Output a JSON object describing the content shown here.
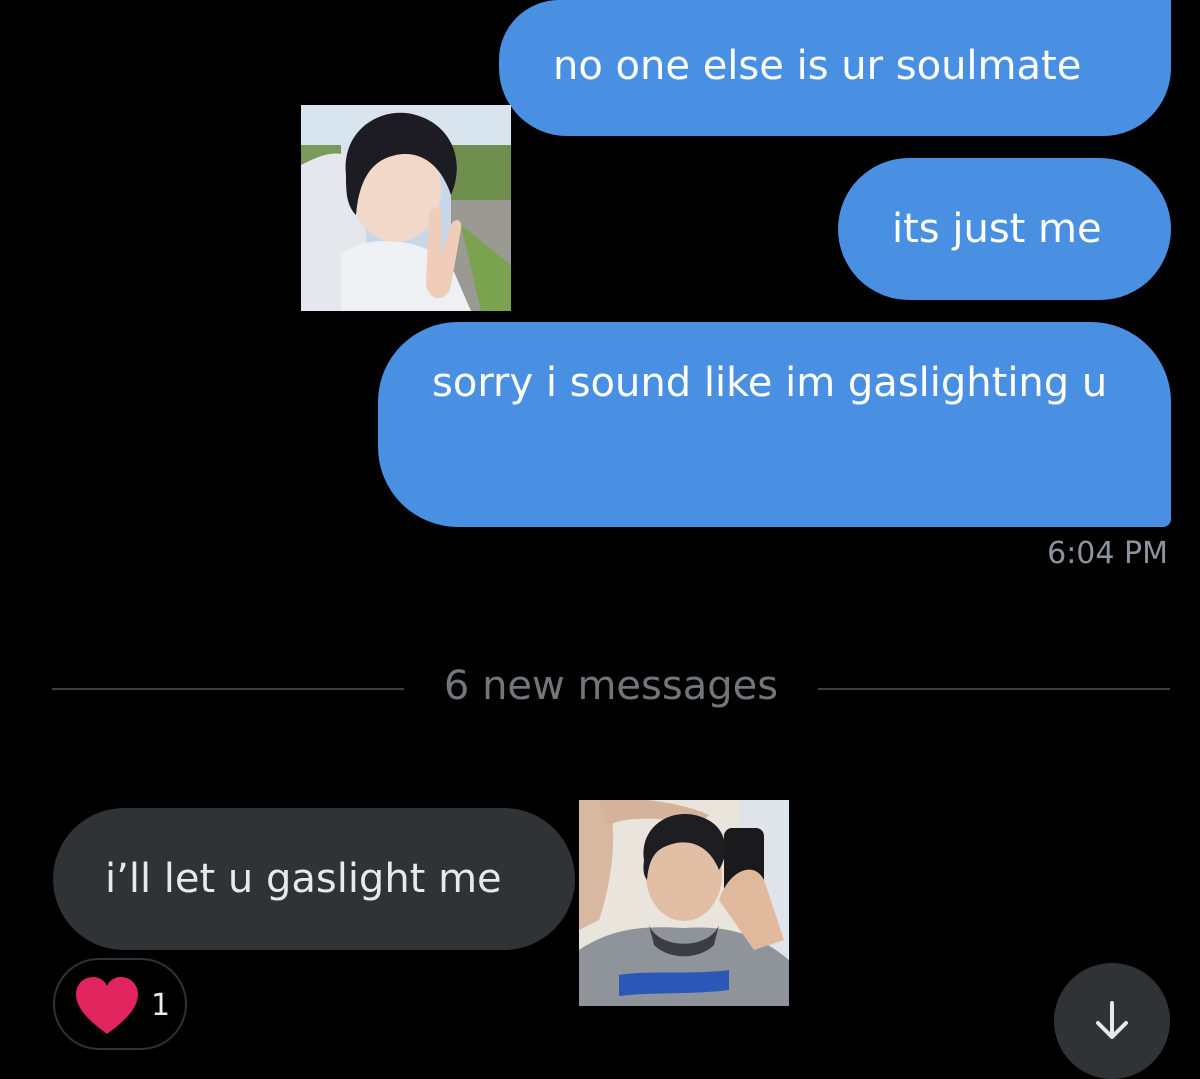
{
  "conversation": {
    "messages": [
      {
        "direction": "outgoing",
        "text": "no one else is ur soulmate"
      },
      {
        "direction": "outgoing",
        "text": "its just me"
      },
      {
        "direction": "outgoing",
        "text": "sorry i sound like im gaslighting u"
      },
      {
        "direction": "incoming",
        "text": "i’ll let u gaslight me"
      }
    ],
    "timestamp": "6:04 PM",
    "new_messages_label": "6 new messages",
    "reaction": {
      "icon": "heart-icon",
      "count": "1",
      "color": "#e0245e"
    },
    "scroll_button": {
      "icon": "arrow-down-icon"
    }
  },
  "overlays": {
    "photo_top": {
      "icon": "selfie-photo"
    },
    "photo_bottom": {
      "icon": "mirror-selfie-photo"
    }
  },
  "colors": {
    "background": "#000000",
    "outgoing_bubble": "#4a90e2",
    "incoming_bubble": "#2f3336",
    "muted_text": "#71767b"
  }
}
